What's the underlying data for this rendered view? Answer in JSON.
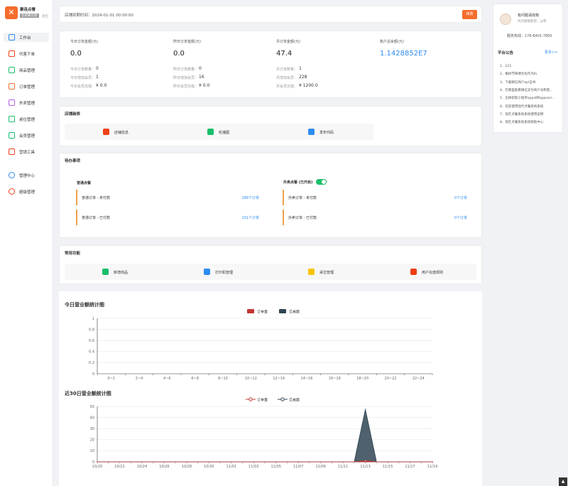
{
  "brand": {
    "name": "聚连点餐",
    "tag": "连锁餐饮版",
    "logout": "退出"
  },
  "nav": [
    {
      "label": "工作台",
      "icon": "monitor-icon",
      "active": true,
      "color": "#2d8cf0"
    },
    {
      "label": "代客下单",
      "icon": "edit-icon",
      "color": "#ed4014"
    },
    {
      "label": "商品管理",
      "icon": "shopping-bag-icon",
      "color": "#19be6b"
    },
    {
      "label": "订单管理",
      "icon": "order-icon",
      "color": "#f56d2c"
    },
    {
      "label": "外卖管理",
      "icon": "delivery-icon",
      "color": "#b45be4"
    },
    {
      "label": "桌位管理",
      "icon": "grid-icon",
      "color": "#19be6b"
    },
    {
      "label": "会员管理",
      "icon": "user-icon",
      "color": "#19be6b"
    },
    {
      "label": "营销工具",
      "icon": "apps-icon",
      "color": "#ed4014"
    },
    {
      "label": "管理中心",
      "icon": "gear-icon",
      "color": "#2d8cf0"
    },
    {
      "label": "超级管理",
      "icon": "settings-icon",
      "color": "#ed4014"
    }
  ],
  "header": {
    "expire_label": "店铺到期时间：",
    "expire_value": "2024-01-01 00:00:00",
    "renew": "续费"
  },
  "stats": [
    {
      "title": "今日订单金额(元)",
      "value": "0.0",
      "rows": [
        [
          "今日订单数量：",
          "0"
        ],
        [
          "今日增加会员：",
          "1"
        ],
        [
          "今日会员充值：",
          "¥ 0.0"
        ]
      ]
    },
    {
      "title": "昨日订单金额(元)",
      "value": "0.0",
      "rows": [
        [
          "昨日订单数量：",
          "0"
        ],
        [
          "昨日增加会员：",
          "16"
        ],
        [
          "昨日会员充值：",
          "¥ 0.0"
        ]
      ]
    },
    {
      "title": "月订单金额(元)",
      "value": "47.4",
      "rows": [
        [
          "月订单数量：",
          "1"
        ],
        [
          "月增加会员：",
          "228"
        ],
        [
          "月会员充值：",
          "¥ 1200.0"
        ]
      ]
    },
    {
      "title": "账户总余额(元)",
      "value": "1.1428852E7",
      "rows": []
    }
  ],
  "decoration": {
    "title": "店铺装修",
    "items": [
      {
        "label": "店铺信息",
        "icon": "store-icon",
        "color": "#ed4014"
      },
      {
        "label": "轮播图",
        "icon": "image-icon",
        "color": "#19be6b"
      },
      {
        "label": "发布代码",
        "icon": "code-icon",
        "color": "#2d8cf0"
      }
    ]
  },
  "todo": {
    "title": "待办事项",
    "normal": {
      "title": "普通点餐",
      "items": [
        {
          "label": "普通订单 - 未付款",
          "count": "286个订单"
        },
        {
          "label": "普通订单 - 已付款",
          "count": "101个订单"
        }
      ]
    },
    "takeout": {
      "title": "外卖点餐 (已开启)",
      "items": [
        {
          "label": "外卖订单 - 未付款",
          "count": "0个订单"
        },
        {
          "label": "外卖订单 - 已付款",
          "count": "0个订单"
        }
      ]
    }
  },
  "common": {
    "title": "常用功能",
    "items": [
      {
        "label": "新增商品",
        "icon": "add-goods-icon",
        "color": "#19be6b"
      },
      {
        "label": "打印机管理",
        "icon": "printer-icon",
        "color": "#2d8cf0"
      },
      {
        "label": "桌位管理",
        "icon": "table-icon",
        "color": "#f5c400"
      },
      {
        "label": "用户充值规则",
        "icon": "recharge-icon",
        "color": "#ed4014"
      }
    ]
  },
  "chart_data": [
    {
      "type": "bar",
      "title": "今日营业额统计图",
      "legend": [
        "订单量",
        "交易额"
      ],
      "categories": [
        "0~2",
        "2~4",
        "4~6",
        "6~8",
        "8~10",
        "10~12",
        "12~14",
        "14~16",
        "16~18",
        "18~20",
        "20~22",
        "22~24"
      ],
      "series": [
        {
          "name": "订单量",
          "values": [
            0,
            0,
            0,
            0,
            0,
            0,
            0,
            0,
            0,
            0,
            0,
            0
          ],
          "color": "#c23531"
        },
        {
          "name": "交易额",
          "values": [
            0,
            0,
            0,
            0,
            0,
            0,
            0,
            0,
            0,
            0,
            0,
            0
          ],
          "color": "#2f4554"
        }
      ],
      "ylim": [
        0,
        1
      ],
      "yticks": [
        "0",
        "0.2",
        "0.4",
        "0.6",
        "0.8",
        "1"
      ],
      "legend_position": "top-center",
      "grid": true
    },
    {
      "type": "area",
      "title": "近30日营业额统计图",
      "legend": [
        "订单量",
        "交易额"
      ],
      "categories": [
        "10/20",
        "10/21",
        "10/22",
        "10/23",
        "10/24",
        "10/25",
        "10/26",
        "10/27",
        "10/28",
        "10/29",
        "10/30",
        "10/31",
        "11/01",
        "11/02",
        "11/03",
        "11/04",
        "11/05",
        "11/06",
        "11/07",
        "11/08",
        "11/09",
        "11/10",
        "11/11",
        "11/12",
        "11/13",
        "11/14",
        "11/15",
        "11/16",
        "11/17",
        "11/18",
        "11/19"
      ],
      "xtick_labels": [
        "10/20",
        "10/22",
        "10/24",
        "10/26",
        "10/28",
        "10/30",
        "11/01",
        "11/03",
        "11/05",
        "11/07",
        "11/09",
        "11/11",
        "11/13",
        "11/15",
        "11/17",
        "11/19"
      ],
      "series": [
        {
          "name": "订单量",
          "values": [
            0,
            0,
            0,
            0,
            0,
            0,
            0,
            0,
            0,
            0,
            0,
            0,
            0,
            0,
            0,
            0,
            0,
            0,
            0,
            0,
            0,
            0,
            0,
            0,
            1,
            0,
            0,
            0,
            0,
            0,
            0
          ],
          "color": "#c23531"
        },
        {
          "name": "交易额",
          "values": [
            0,
            0,
            0,
            0,
            0,
            0,
            0,
            0,
            0,
            0,
            0,
            0,
            0,
            0,
            0,
            0,
            0,
            0,
            0,
            0,
            0,
            0,
            0,
            0,
            47.4,
            0,
            0,
            0,
            0,
            0,
            0
          ],
          "color": "#2f4554"
        }
      ],
      "ylim": [
        0,
        50
      ],
      "yticks": [
        "0",
        "10",
        "20",
        "30",
        "40",
        "50"
      ],
      "legend_position": "top-center",
      "grid": true
    }
  ],
  "notice": {
    "contact_title": "有问题请找我",
    "contact_sub": "何问题都能帮，@我",
    "phone": "服务热线：176-6401-7800",
    "title": "平台公告",
    "more": "更多>>",
    "items": [
      "1、123",
      "2、植树节微博文化作为IS",
      "3、下载微信商户api证书",
      "4、在哪里能看微信支付商户号和密...",
      "5、怎样获取小程序appid和appsecr...",
      "6、欢迎使用现代点餐系统系统",
      "7、现在点餐系统系统使用说明",
      "8、现在点餐系统系统帮助中心"
    ]
  }
}
